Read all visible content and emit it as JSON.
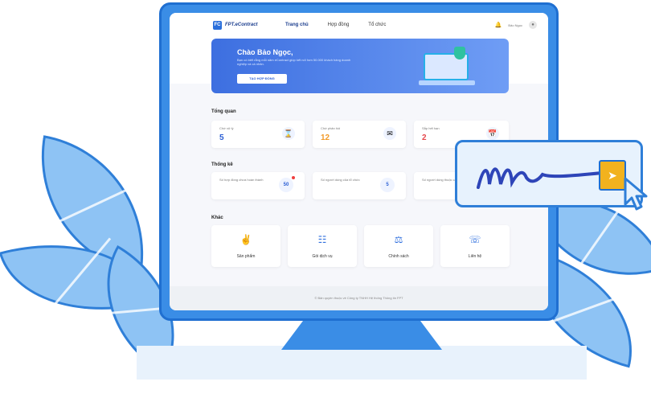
{
  "nav": {
    "logo_mark": "FC",
    "logo_text": "FPT.eContract",
    "items": [
      {
        "label": "Trang chủ",
        "active": true
      },
      {
        "label": "Hợp đồng",
        "active": false
      },
      {
        "label": "Tổ chức",
        "active": false
      }
    ],
    "user_name": "Bảo Ngọc",
    "bell_icon": "bell-icon"
  },
  "banner": {
    "title": "Chào Bảo Ngọc,",
    "description": "Bạn có biết rằng mỗi năm eContract giúp kết nối hơn 50.000 khách hàng doanh nghiệp và cá nhân.",
    "button_label": "TẠO HỢP ĐỒNG"
  },
  "overview": {
    "title": "Tổng quan",
    "cards": [
      {
        "label": "Chờ xử lý",
        "value": "5",
        "color": "#2a5ed4",
        "icon": "hourglass-icon"
      },
      {
        "label": "Chờ phản hồi",
        "value": "12",
        "color": "#f29b2a",
        "icon": "mail-icon"
      },
      {
        "label": "Sắp hết hạn",
        "value": "2",
        "color": "#e5484d",
        "icon": "calendar-icon"
      }
    ]
  },
  "stats": {
    "title": "Thống kê",
    "cards": [
      {
        "label": "Số hợp đồng chưa hoàn thành",
        "value": "50"
      },
      {
        "label": "Số người dùng của tổ chức",
        "value": "5"
      },
      {
        "label": "Số người dùng thuộc các đơn vị con",
        "value": ""
      }
    ]
  },
  "other": {
    "title": "Khác",
    "items": [
      {
        "label": "Sản phẩm",
        "icon": "product-icon"
      },
      {
        "label": "Gói dịch vụ",
        "icon": "service-package-icon"
      },
      {
        "label": "Chính sách",
        "icon": "policy-icon"
      },
      {
        "label": "Liên hệ",
        "icon": "contact-icon"
      }
    ]
  },
  "footer": {
    "text": "© Bản quyền thuộc về Công ty TNHH Hệ thống Thông tin FPT"
  }
}
